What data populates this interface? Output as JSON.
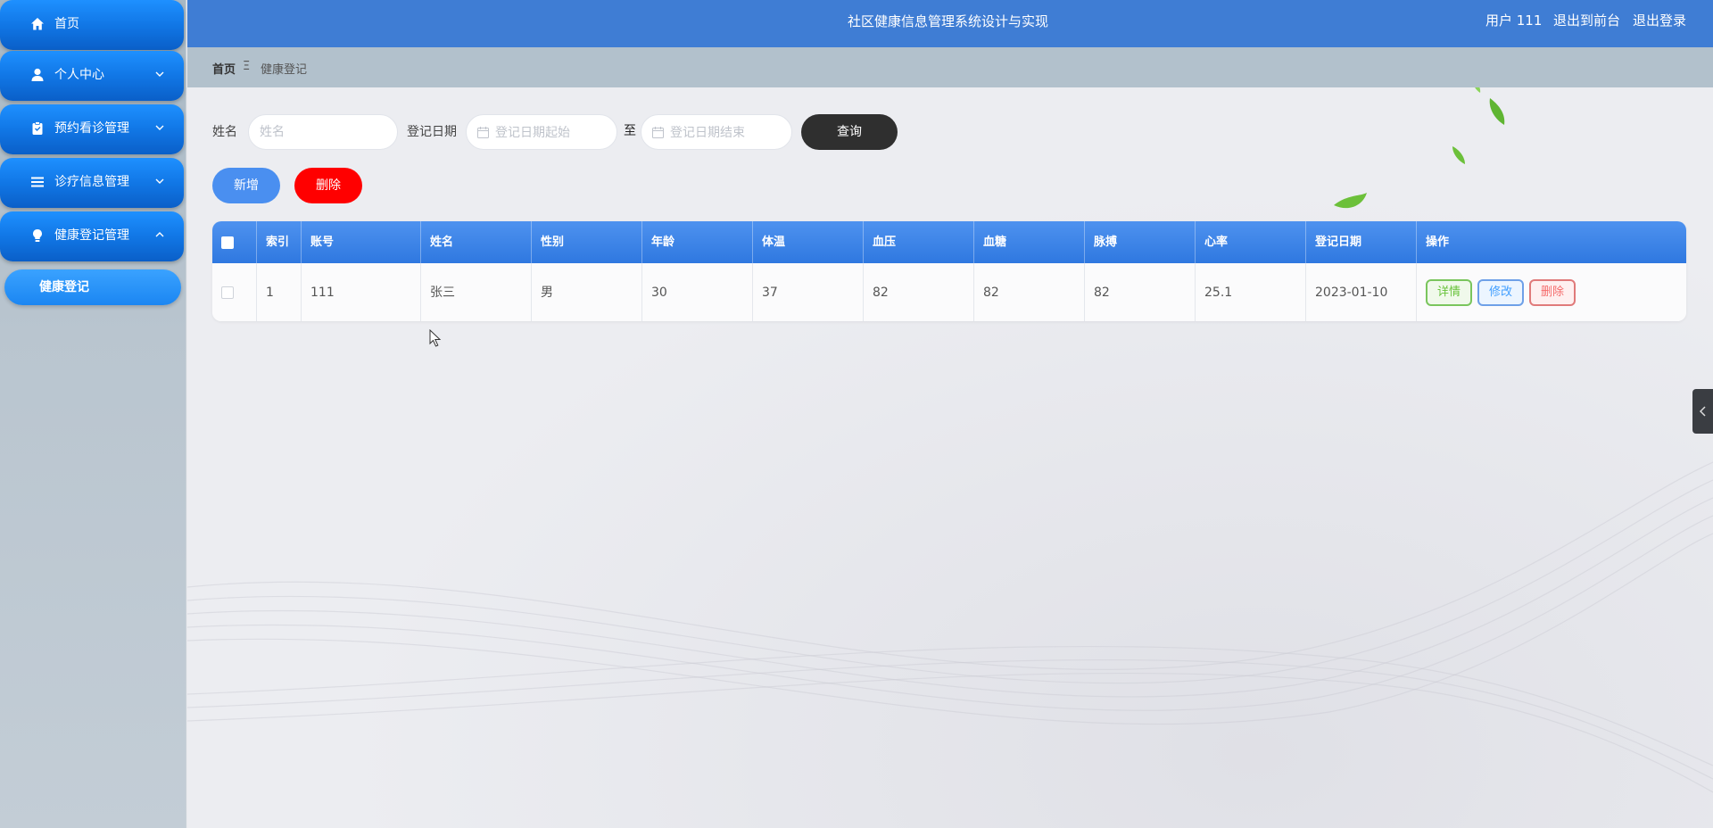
{
  "app": {
    "title": "社区健康信息管理系统设计与实现",
    "user_label": "用户 111",
    "front_link": "退出到前台",
    "logout_link": "退出登录"
  },
  "sidebar": {
    "items": [
      {
        "label": "首页",
        "icon": "home-icon"
      },
      {
        "label": "个人中心",
        "icon": "user-icon"
      },
      {
        "label": "预约看诊管理",
        "icon": "clipboard-icon"
      },
      {
        "label": "诊疗信息管理",
        "icon": "list-icon"
      },
      {
        "label": "健康登记管理",
        "icon": "lightbulb-icon"
      }
    ],
    "subitem": {
      "label": "健康登记"
    }
  },
  "breadcrumb": {
    "home": "首页",
    "separator": "Ξ",
    "current": "健康登记"
  },
  "search": {
    "name_label": "姓名",
    "name_placeholder": "姓名",
    "date_label": "登记日期",
    "date_start_placeholder": "登记日期起始",
    "date_to": "至",
    "date_end_placeholder": "登记日期结束",
    "query_button": "查询"
  },
  "actions": {
    "add_button": "新增",
    "delete_button": "删除"
  },
  "table": {
    "columns": [
      "索引",
      "账号",
      "姓名",
      "性别",
      "年龄",
      "体温",
      "血压",
      "血糖",
      "脉搏",
      "心率",
      "登记日期",
      "操作"
    ],
    "rows": [
      {
        "index": "1",
        "account": "111",
        "name": "张三",
        "gender": "男",
        "age": "30",
        "temperature": "37",
        "blood_pressure": "82",
        "blood_sugar": "82",
        "pulse": "82",
        "heart_rate": "25.1",
        "date": "2023-01-10"
      }
    ],
    "row_actions": {
      "detail": "详情",
      "edit": "修改",
      "remove": "删除"
    }
  },
  "colors": {
    "header_bg": "#3f7dd4",
    "sidebar_button": "#1177e6",
    "query_button": "#2f2f2f",
    "add_button": "#4a8ff0",
    "delete_button": "#ff0000",
    "table_header": "#3f85e8"
  }
}
